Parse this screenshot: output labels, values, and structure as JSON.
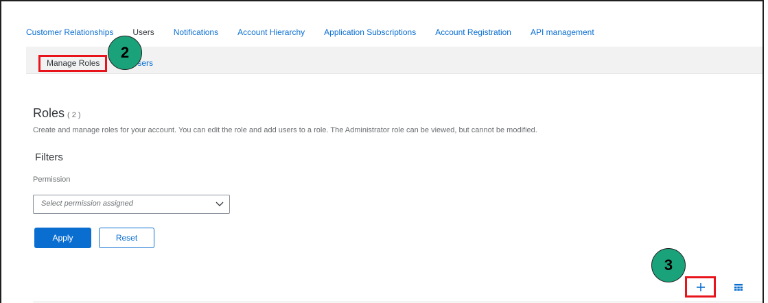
{
  "top_nav": {
    "items": [
      "Customer Relationships",
      "Users",
      "Notifications",
      "Account Hierarchy",
      "Application Subscriptions",
      "Account Registration",
      "API management"
    ]
  },
  "sub_tabs": {
    "active": "Manage Roles",
    "other": "ge Users"
  },
  "annotations": {
    "step2": "2",
    "step3": "3",
    "highlight_color": "#e8141c",
    "badge_color": "#1aa37a"
  },
  "roles": {
    "title": "Roles",
    "count": "( 2 )",
    "description": "Create and manage roles for your account. You can edit the role and add users to a role. The Administrator role can be viewed, but cannot be modified."
  },
  "filters": {
    "heading": "Filters",
    "permission_label": "Permission",
    "permission_placeholder": "Select permission assigned",
    "apply_label": "Apply",
    "reset_label": "Reset"
  },
  "toolbar": {
    "add_icon": "plus-icon",
    "settings_icon": "table-settings-icon"
  },
  "colors": {
    "link": "#0a6ed1",
    "text": "#32363a",
    "muted": "#6a6d70"
  }
}
